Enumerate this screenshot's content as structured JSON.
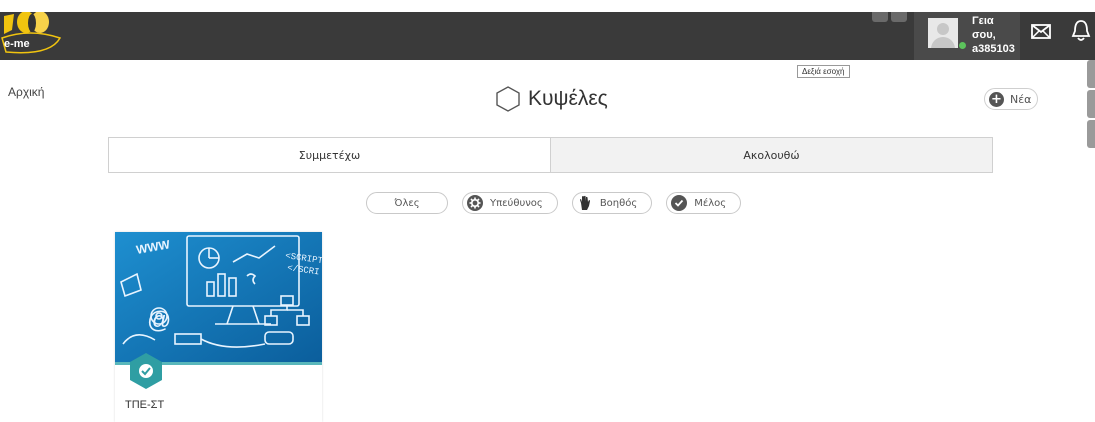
{
  "header": {
    "logo_text": "e-me",
    "greeting_line1": "Γεια σου,",
    "greeting_line2": "a385103",
    "icons": [
      "mail-icon",
      "bell-icon"
    ]
  },
  "breadcrumb": "Αρχική",
  "tooltip": "Δεξιά εσοχή",
  "page": {
    "title": "Κυψέλες",
    "title_icon": "hexagon-icon",
    "new_button": "Νέα"
  },
  "tabs": [
    {
      "label": "Συμμετέχω",
      "active": true
    },
    {
      "label": "Ακολουθώ",
      "active": false
    }
  ],
  "filters": [
    {
      "label": "Όλες",
      "icon": ""
    },
    {
      "label": "Υπεύθυνος",
      "icon": "gear-icon"
    },
    {
      "label": "Βοηθός",
      "icon": "hand-icon"
    },
    {
      "label": "Μέλος",
      "icon": "check-icon"
    }
  ],
  "cards": [
    {
      "title": "ΤΠΕ-ΣΤ",
      "badge_icon": "check-shield-icon"
    }
  ],
  "colors": {
    "topbar": "#3a3a3a",
    "accent_teal": "#2f9ea3",
    "card_image_bg": "#1a7fc1"
  }
}
